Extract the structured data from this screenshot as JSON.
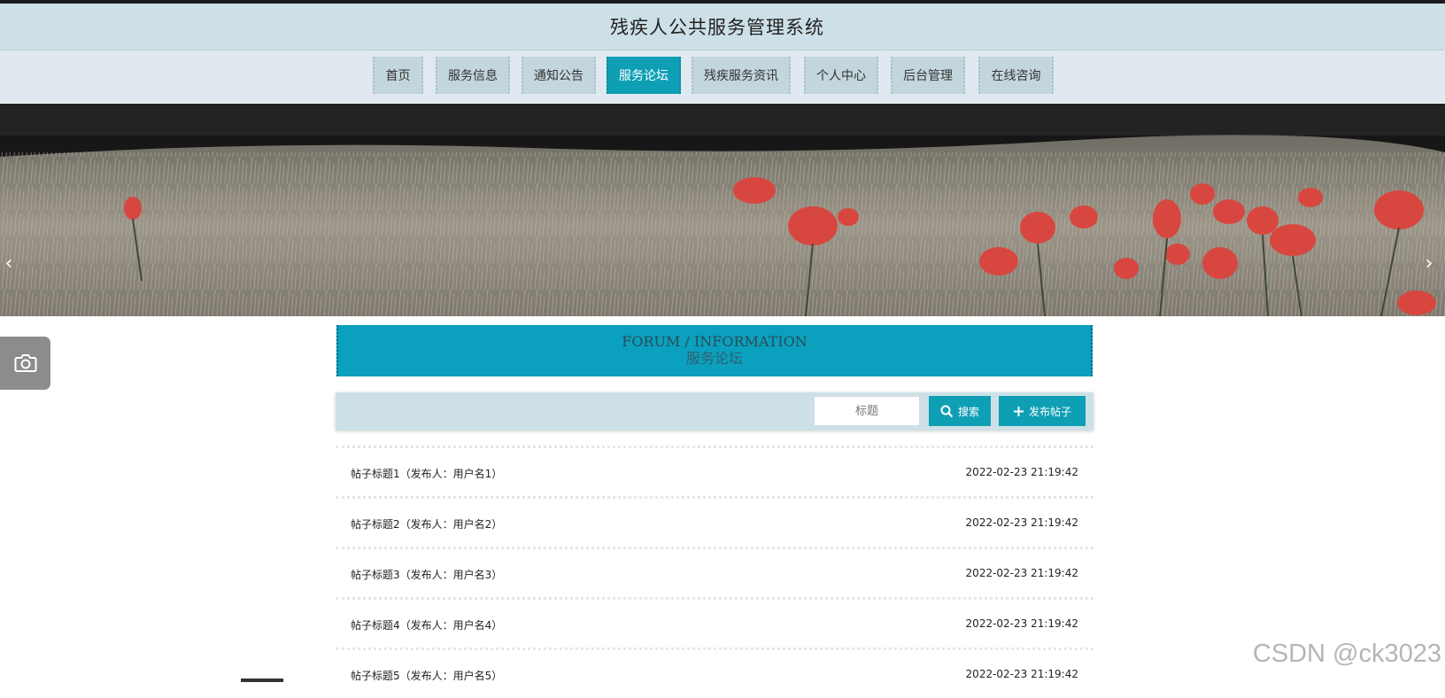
{
  "header": {
    "title": "残疾人公共服务管理系统"
  },
  "nav": {
    "items": [
      {
        "label": "首页"
      },
      {
        "label": "服务信息"
      },
      {
        "label": "通知公告"
      },
      {
        "label": "服务论坛"
      },
      {
        "label": "残疾服务资讯"
      },
      {
        "label": "个人中心"
      },
      {
        "label": "后台管理"
      },
      {
        "label": "在线咨询"
      }
    ],
    "active_label": "服务论坛"
  },
  "banner": {
    "prev": "‹",
    "next": "›"
  },
  "section": {
    "title_en": "FORUM / INFORMATION",
    "title_cn": "服务论坛"
  },
  "search": {
    "placeholder": "标题",
    "search_label": "搜索",
    "publish_label": "发布帖子"
  },
  "posts": [
    {
      "title": "帖子标题1（发布人：用户名1）",
      "time": "2022-02-23 21:19:42"
    },
    {
      "title": "帖子标题2（发布人：用户名2）",
      "time": "2022-02-23 21:19:42"
    },
    {
      "title": "帖子标题3（发布人：用户名3）",
      "time": "2022-02-23 21:19:42"
    },
    {
      "title": "帖子标题4（发布人：用户名4）",
      "time": "2022-02-23 21:19:42"
    },
    {
      "title": "帖子标题5（发布人：用户名5）",
      "time": "2022-02-23 21:19:42"
    }
  ],
  "watermark": "CSDN @ck3023",
  "colors": {
    "accent": "#0f9fb5",
    "header_bg": "#cde0e7",
    "nav_bg": "#dfe9ef"
  },
  "icons": [
    "camera-icon",
    "search-icon",
    "plus-icon",
    "chevron-left-icon",
    "chevron-right-icon"
  ]
}
